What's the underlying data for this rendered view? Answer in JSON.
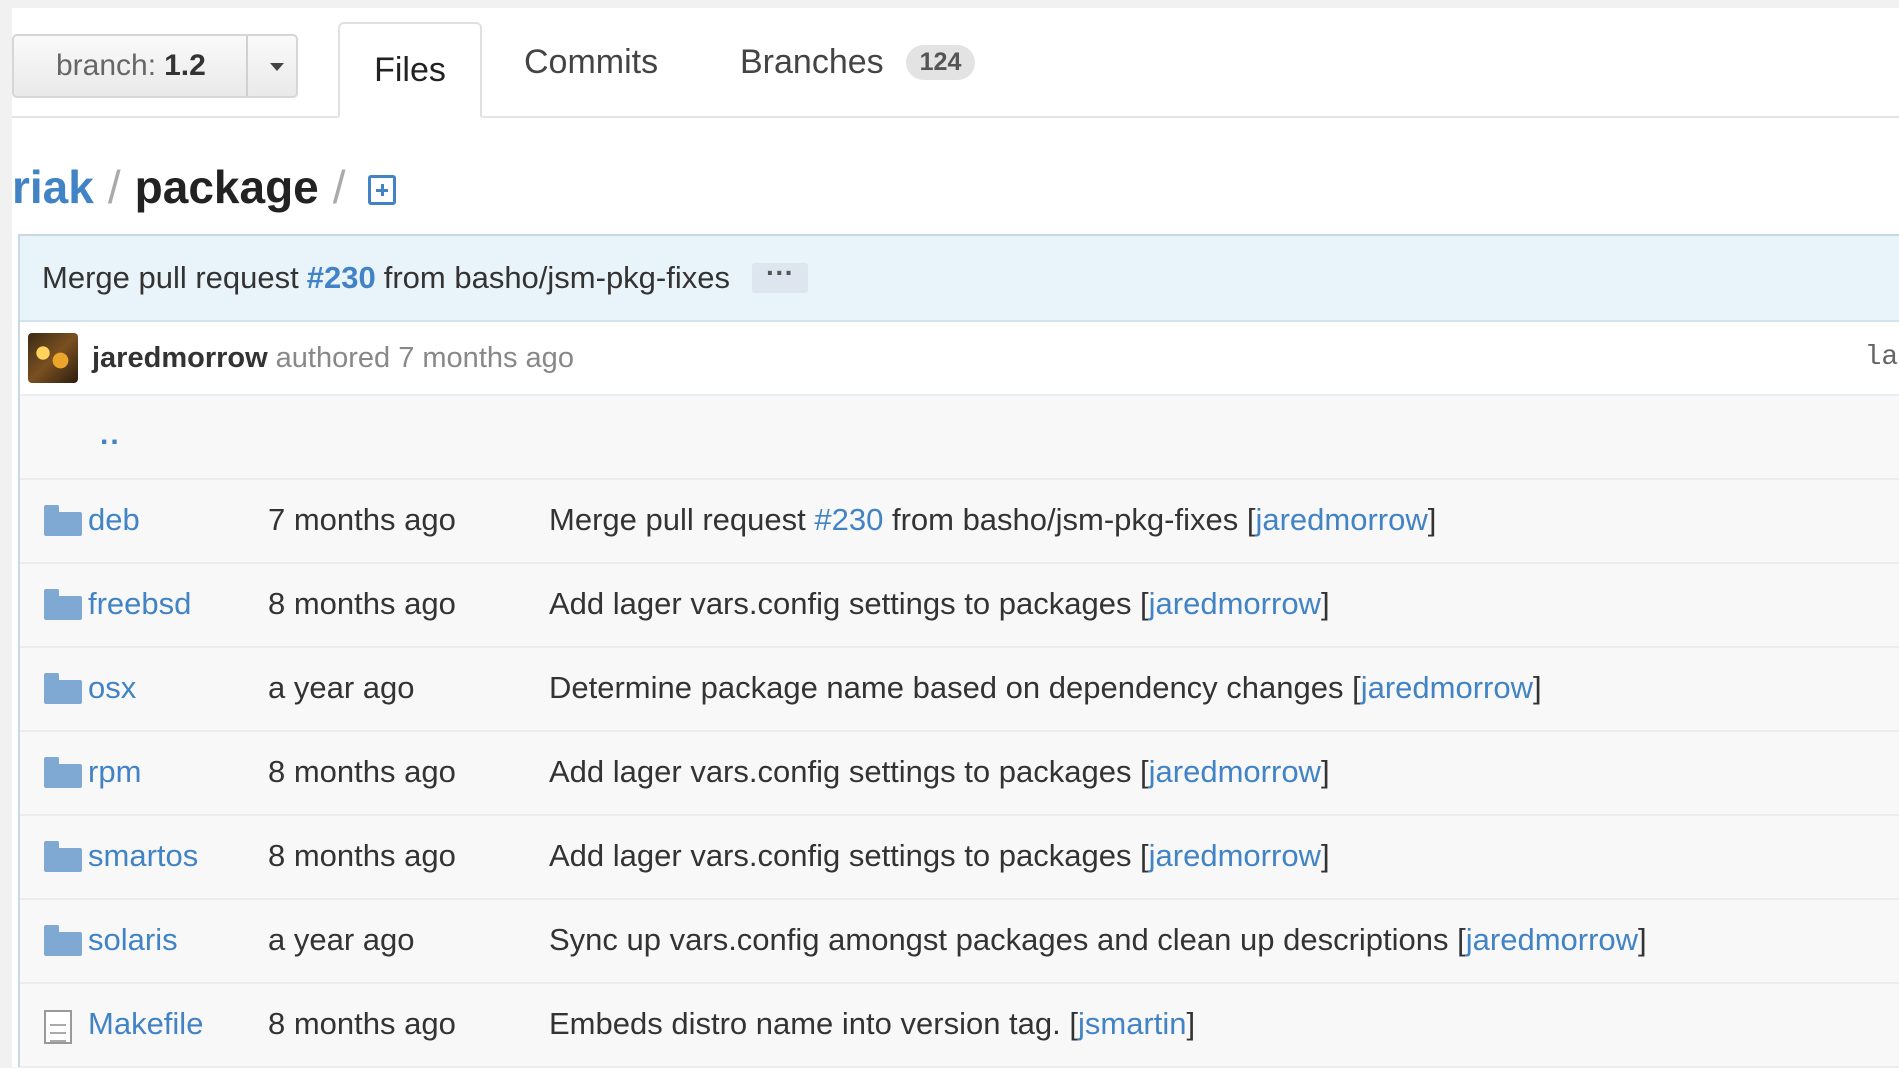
{
  "branch_selector": {
    "prefix": "branch:",
    "value": "1.2"
  },
  "tabs": {
    "files": "Files",
    "commits": "Commits",
    "branches": "Branches",
    "branches_count": "124"
  },
  "breadcrumb": {
    "repo": "riak",
    "separator": "/",
    "current": "package",
    "trailing_separator": "/"
  },
  "commit": {
    "message_prefix": "Merge pull request",
    "pr_number": "#230",
    "message_suffix": "from basho/jsm-pkg-fixes",
    "expand_label": "···",
    "author": "jaredmorrow",
    "authored_text": "authored 7 months ago",
    "latest_label": "lat"
  },
  "parent_dir": "..",
  "files": [
    {
      "type": "folder",
      "name": "deb",
      "age": "7 months ago",
      "msg_before": "Merge pull request ",
      "msg_link": "#230",
      "msg_after": " from basho/jsm-pkg-fixes [",
      "author": "jaredmorrow",
      "close": "]"
    },
    {
      "type": "folder",
      "name": "freebsd",
      "age": "8 months ago",
      "msg_before": "Add lager vars.config settings to packages [",
      "msg_link": "",
      "msg_after": "",
      "author": "jaredmorrow",
      "close": "]"
    },
    {
      "type": "folder",
      "name": "osx",
      "age": "a year ago",
      "msg_before": "Determine package name based on dependency changes [",
      "msg_link": "",
      "msg_after": "",
      "author": "jaredmorrow",
      "close": "]"
    },
    {
      "type": "folder",
      "name": "rpm",
      "age": "8 months ago",
      "msg_before": "Add lager vars.config settings to packages [",
      "msg_link": "",
      "msg_after": "",
      "author": "jaredmorrow",
      "close": "]"
    },
    {
      "type": "folder",
      "name": "smartos",
      "age": "8 months ago",
      "msg_before": "Add lager vars.config settings to packages [",
      "msg_link": "",
      "msg_after": "",
      "author": "jaredmorrow",
      "close": "]"
    },
    {
      "type": "folder",
      "name": "solaris",
      "age": "a year ago",
      "msg_before": "Sync up vars.config amongst packages and clean up descriptions [",
      "msg_link": "",
      "msg_after": "",
      "author": "jaredmorrow",
      "close": "]"
    },
    {
      "type": "file",
      "name": "Makefile",
      "age": "8 months ago",
      "msg_before": "Embeds distro name into version tag. [",
      "msg_link": "",
      "msg_after": "",
      "author": "jsmartin",
      "close": "]"
    }
  ]
}
